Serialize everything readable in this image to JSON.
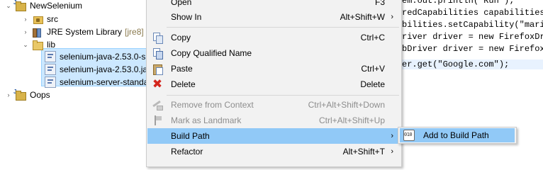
{
  "tree": {
    "items": [
      {
        "label": "NewSelenium",
        "icon": "java-project-icon",
        "twisty": "expanded"
      },
      {
        "label": "src",
        "icon": "source-folder-icon",
        "twisty": "collapsed"
      },
      {
        "label": "JRE System Library",
        "suffix": "[jre8]",
        "icon": "library-icon",
        "twisty": "collapsed"
      },
      {
        "label": "lib",
        "icon": "folder-icon",
        "twisty": "expanded"
      },
      {
        "label": "selenium-java-2.53.0-s",
        "icon": "jar-file-icon"
      },
      {
        "label": "selenium-java-2.53.0.ja",
        "icon": "jar-file-icon"
      },
      {
        "label": "selenium-server-standa",
        "icon": "jar-file-icon"
      },
      {
        "label": "Oops",
        "icon": "java-project-icon",
        "twisty": "collapsed"
      }
    ]
  },
  "editor": {
    "lines": [
      "em.out.println(\"Run\");",
      "redCapabilities capabilities=",
      "bilities.setCapability(\"mario",
      "river driver = new FirefoxDri",
      "bDriver driver = new FirefoxD",
      "er.get(\"Google.com\");"
    ]
  },
  "menu": {
    "items": [
      {
        "label": "Open",
        "shortcut": "F3",
        "enabled": true
      },
      {
        "label": "Show In",
        "shortcut": "Alt+Shift+W",
        "submenu": true,
        "enabled": true
      },
      {
        "label": "Copy",
        "shortcut": "Ctrl+C",
        "icon": "copy-icon",
        "enabled": true
      },
      {
        "label": "Copy Qualified Name",
        "shortcut": "",
        "icon": "copy-qualified-name-icon",
        "enabled": true
      },
      {
        "label": "Paste",
        "shortcut": "Ctrl+V",
        "icon": "paste-icon",
        "enabled": true
      },
      {
        "label": "Delete",
        "shortcut": "Delete",
        "icon": "delete-icon",
        "enabled": true
      },
      {
        "label": "Remove from Context",
        "shortcut": "Ctrl+Alt+Shift+Down",
        "icon": "remove-from-context-icon",
        "enabled": false
      },
      {
        "label": "Mark as Landmark",
        "shortcut": "Ctrl+Alt+Shift+Up",
        "icon": "landmark-icon",
        "enabled": false
      },
      {
        "label": "Build Path",
        "shortcut": "",
        "submenu": true,
        "enabled": true,
        "active": true
      },
      {
        "label": "Refactor",
        "shortcut": "Alt+Shift+T",
        "submenu": true,
        "enabled": true
      }
    ],
    "submenu_arrow": "›"
  },
  "submenu": {
    "label": "Add to Build Path",
    "icon": "add-to-build-path-icon"
  },
  "colors": {
    "menu_bg": "#f2f2f2",
    "highlight": "#91c9f7",
    "selection": "#cce8ff",
    "disabled_text": "#8d8d8d",
    "delete_red": "#d4261e"
  }
}
